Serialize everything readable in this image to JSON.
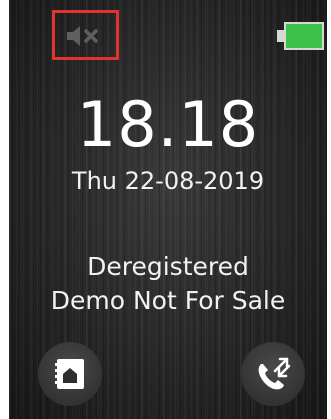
{
  "status_bar": {
    "mute_icon": "speaker-muted-icon",
    "battery_icon": "battery-full-icon",
    "battery_color": "#3fc24a",
    "highlight_color": "#e0342f"
  },
  "idle": {
    "time": "18.18",
    "date": "Thu 22-08-2019",
    "status_line_1": "Deregistered",
    "status_line_2": "Demo Not For Sale"
  },
  "softkeys": {
    "left_icon": "phonebook-icon",
    "right_icon": "call-log-icon"
  }
}
